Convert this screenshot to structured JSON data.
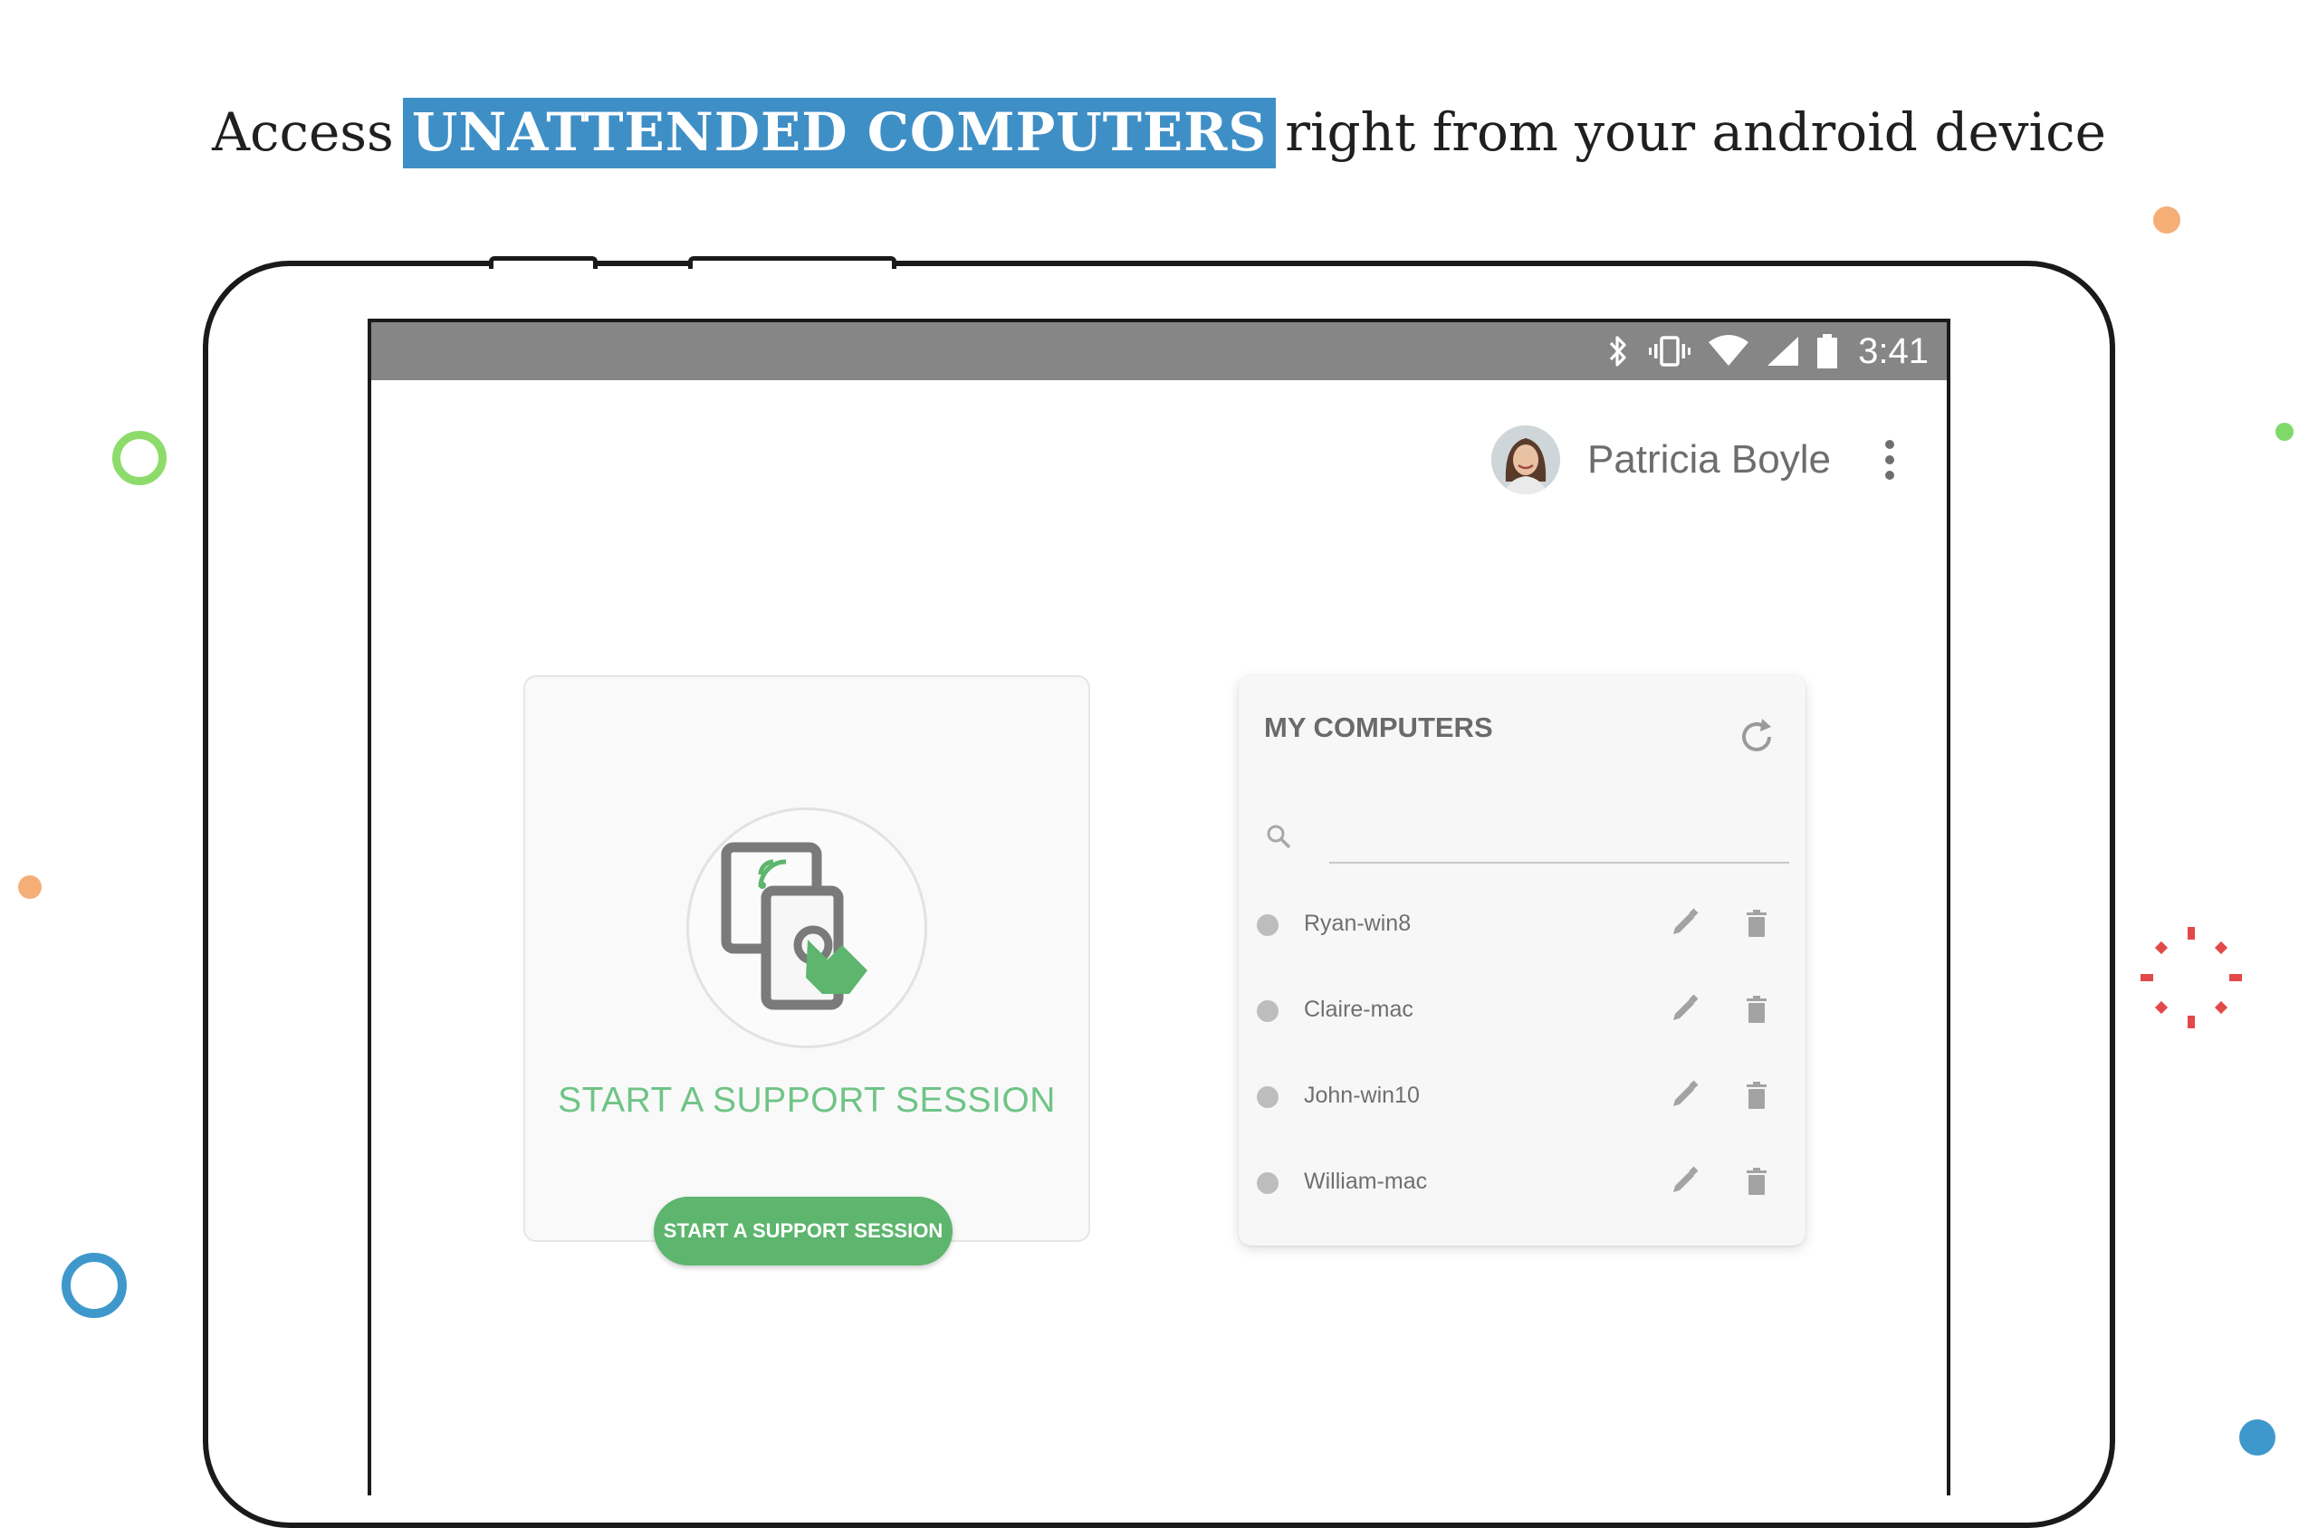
{
  "headline": {
    "prefix": "Access",
    "highlight": "UNATTENDED COMPUTERS",
    "suffix": "right from your android device"
  },
  "colors": {
    "highlight_bg": "#3f8fc7",
    "accent_green": "#5db56e",
    "status_bar": "#868686"
  },
  "status_bar": {
    "icons": [
      "bluetooth-icon",
      "vibrate-icon",
      "wifi-icon",
      "cell-signal-icon",
      "battery-icon"
    ],
    "time": "3:41"
  },
  "user": {
    "name": "Patricia Boyle",
    "menu_icon": "more-vertical-icon"
  },
  "support": {
    "title": "START A SUPPORT SESSION",
    "button_label": "START A SUPPORT SESSION",
    "illustration": "remote-touch-icon"
  },
  "computers": {
    "title": "MY COMPUTERS",
    "refresh_icon": "refresh-icon",
    "search_placeholder": "",
    "items": [
      {
        "name": "Ryan-win8"
      },
      {
        "name": "Claire-mac"
      },
      {
        "name": "John-win10"
      },
      {
        "name": "William-mac"
      }
    ]
  }
}
